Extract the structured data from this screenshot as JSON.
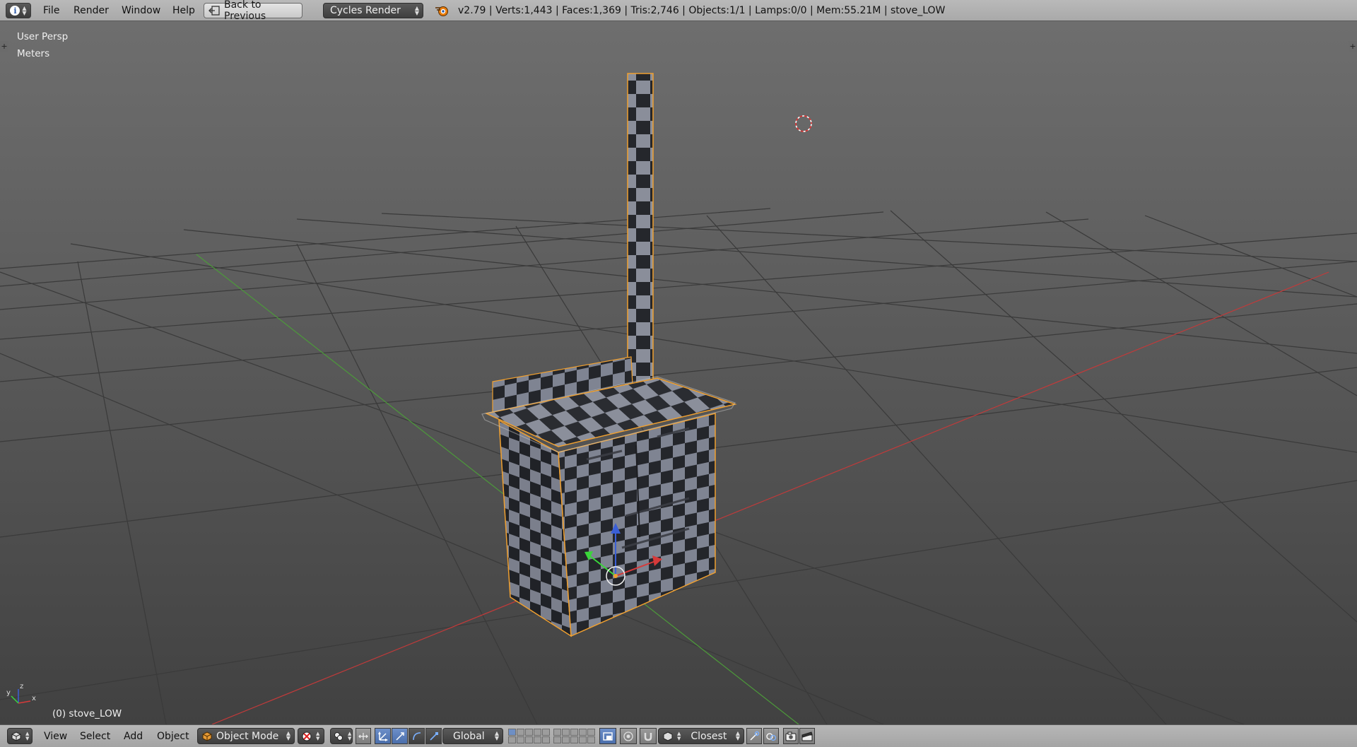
{
  "header": {
    "editor_type_icon": "info-icon",
    "menu": [
      "File",
      "Render",
      "Window",
      "Help"
    ],
    "back_button": "Back to Previous",
    "render_engine": "Cycles Render",
    "stats": "v2.79 | Verts:1,443 | Faces:1,369 | Tris:2,746 | Objects:1/1 | Lamps:0/0 | Mem:55.21M | stove_LOW"
  },
  "viewport": {
    "view_name": "User Persp",
    "units": "Meters",
    "object_info": "(0) stove_LOW",
    "axis_labels": {
      "x": "x",
      "y": "y",
      "z": "z"
    }
  },
  "footer": {
    "menu": [
      "View",
      "Select",
      "Add",
      "Object"
    ],
    "mode": "Object Mode",
    "orientation": "Global",
    "snap_target": "Closest"
  },
  "colors": {
    "x_axis": "#c23a3a",
    "y_axis": "#4c9a3a",
    "selection_outline": "#f0a030",
    "header_bg": "#b0b0b0"
  }
}
